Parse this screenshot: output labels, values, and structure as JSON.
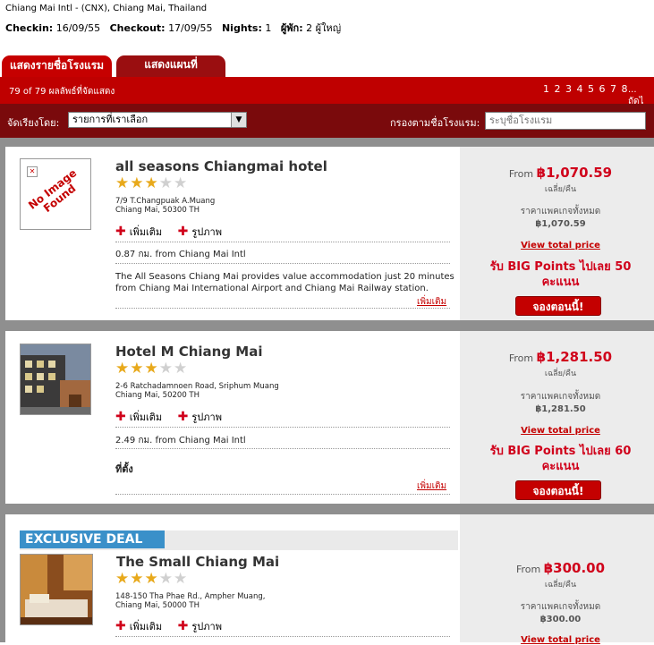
{
  "header": {
    "location": "Chiang Mai Intl - (CNX), Chiang Mai, Thailand",
    "checkin_label": "Checkin:",
    "checkin_value": "16/09/55",
    "checkout_label": "Checkout:",
    "checkout_value": "17/09/55",
    "nights_label": "Nights:",
    "nights_value": "1",
    "guests_label": "ผู้พัก:",
    "guests_value": "2 ผู้ใหญ่"
  },
  "tabs": [
    {
      "label": "แสดงรายชื่อโรงแรม"
    },
    {
      "label": "แสดงแผนที่"
    }
  ],
  "results": {
    "count": "79 of 79 ผลลัพธ์ที่จัดแสดง",
    "pages": "1 2 3 4 5 6 7 8",
    "next": "... ถัดไ"
  },
  "sort": {
    "label": "จัดเรียงโดย:",
    "value": "รายการที่เราเลือก",
    "dropdown": "▼"
  },
  "filter": {
    "label": "กรองตามชื่อโรงแรม:",
    "placeholder": "ระบุชื่อโรงแรม"
  },
  "common": {
    "more_info": "เพิ่มเติม",
    "photos": "รูปภาพ",
    "from": "From",
    "per_night": "เฉลี่ย/คืน",
    "package_price": "ราคาแพคเกจทั้งหมด",
    "view_total": "View total price",
    "read_more": "เพิ่มเติม",
    "book_now": "จองตอนนี้!"
  },
  "hotels": [
    {
      "name": "all seasons Chiangmai hotel",
      "stars": 3,
      "no_image": "No Image Found",
      "address1": "7/9 T.Changpuak A.Muang",
      "address2": "Chiang Mai, 50300 TH",
      "distance": "0.87 กม. from Chiang Mai Intl",
      "desc": "The All Seasons Chiang Mai provides value accommodation just 20 minutes from Chiang Mai International Airport and Chiang Mai Railway station.",
      "price": "฿1,070.59",
      "package": "฿1,070.59",
      "points": "รับ BIG Points ไปเลย 50 คะแนน"
    },
    {
      "name": "Hotel M Chiang Mai",
      "stars": 3,
      "address1": "2-6 Ratchadamnoen Road, Sriphum Muang",
      "address2": "Chiang Mai, 50200 TH",
      "distance": "2.49 กม. from Chiang Mai Intl",
      "section": "ที่ตั้ง",
      "price": "฿1,281.50",
      "package": "฿1,281.50",
      "points": "รับ BIG Points ไปเลย 60 คะแนน"
    },
    {
      "name": "The Small Chiang Mai",
      "stars": 3,
      "badge": "EXCLUSIVE DEAL",
      "address1": "148-150 Tha Phae Rd., Ampher Muang,",
      "address2": "Chiang Mai, 50000 TH",
      "price": "฿300.00",
      "package": "฿300.00"
    }
  ]
}
